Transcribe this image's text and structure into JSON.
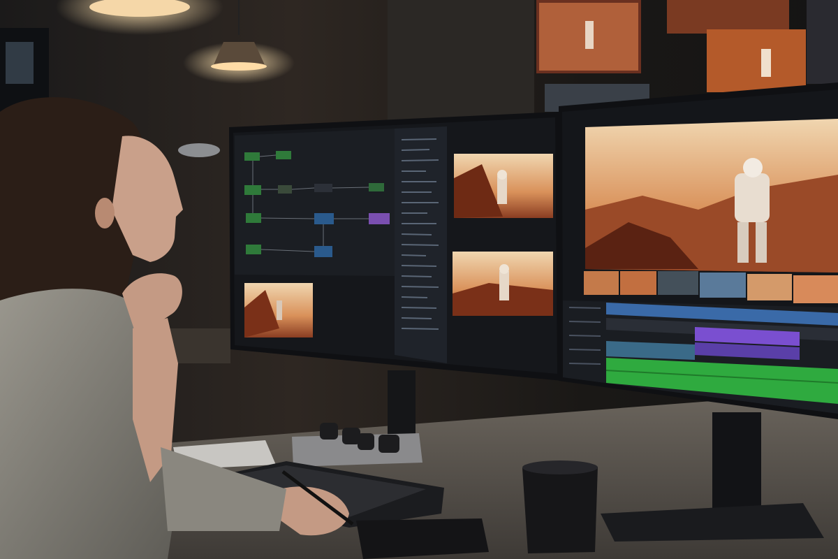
{
  "scene": {
    "subject": "person",
    "setting": "dim studio",
    "palette": {
      "wall": "#2a2420",
      "desk": "#5c564f",
      "shirt": "#8c8a82",
      "skin": "#c9a08a",
      "hair": "#2b1e17",
      "monitor_bezel": "#101114",
      "ui_panel": "#1c1f24",
      "ui_panel_dark": "#15171b",
      "node_green": "#2f7a3a",
      "node_blue": "#2a5a8c",
      "node_purple": "#7a4fb0",
      "track_green": "#2faa3f",
      "track_purple": "#7a4fd0",
      "track_blue": "#3a6aa8",
      "sky_warm": "#e6b07a",
      "terrain": "#8a3d22",
      "lamp": "#ffd9a0"
    },
    "objects": [
      "pendant-lamp",
      "pendant-lamp",
      "left-monitor",
      "right-monitor",
      "keyboard",
      "control-knobs",
      "mug",
      "drawing-tablet",
      "stylus",
      "wall-photos"
    ]
  }
}
